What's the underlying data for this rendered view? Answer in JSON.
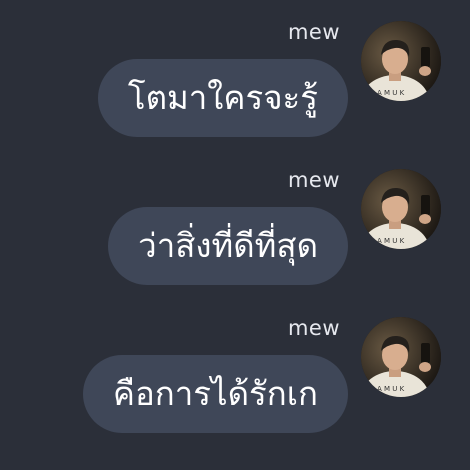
{
  "messages": [
    {
      "sender": "mew",
      "text": "โตมาใครจะรู้",
      "avatar_icon": "user-avatar-photo"
    },
    {
      "sender": "mew",
      "text": "ว่าสิ่งที่ดีที่สุด",
      "avatar_icon": "user-avatar-photo"
    },
    {
      "sender": "mew",
      "text": "คือการได้รักเก",
      "avatar_icon": "user-avatar-photo"
    }
  ],
  "colors": {
    "background": "#2b2f39",
    "bubble": "#3f4758",
    "bubble_text": "#ffffff",
    "sender_text": "#e6e8ee"
  }
}
